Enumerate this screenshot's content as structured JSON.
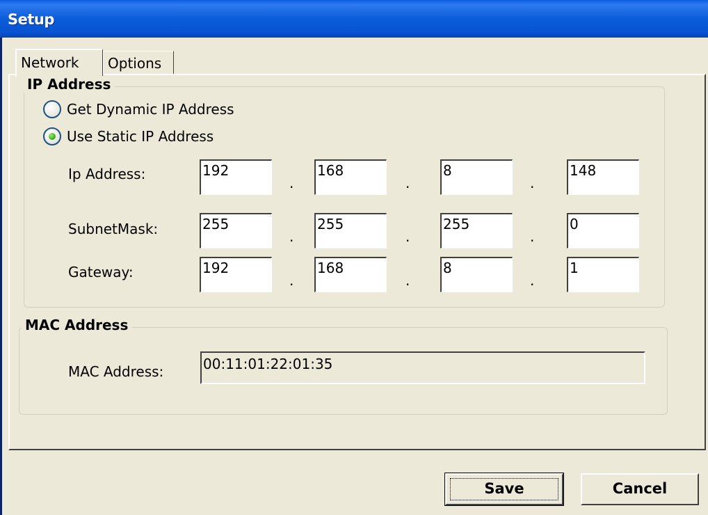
{
  "window": {
    "title": "Setup"
  },
  "tabs": [
    {
      "label": "Network",
      "active": true
    },
    {
      "label": "Options",
      "active": false
    }
  ],
  "ip_group": {
    "legend": "IP Address",
    "radio_dynamic": {
      "label": "Get Dynamic IP Address",
      "selected": false
    },
    "radio_static": {
      "label": "Use Static IP Address",
      "selected": true
    },
    "ip_address": {
      "label": "Ip Address:",
      "octets": [
        "192",
        "168",
        "8",
        "148"
      ]
    },
    "subnet_mask": {
      "label": "SubnetMask:",
      "octets": [
        "255",
        "255",
        "255",
        "0"
      ]
    },
    "gateway": {
      "label": "Gateway:",
      "octets": [
        "192",
        "168",
        "8",
        "1"
      ]
    },
    "separator": "."
  },
  "mac_group": {
    "legend": "MAC Address",
    "label": "MAC Address:",
    "value": "00:11:01:22:01:35"
  },
  "buttons": {
    "save": "Save",
    "cancel": "Cancel"
  },
  "colors": {
    "titlebar": "#0A5CE2",
    "dialog_bg": "#ECE9D8",
    "radio_selected": "#3FB31C"
  }
}
